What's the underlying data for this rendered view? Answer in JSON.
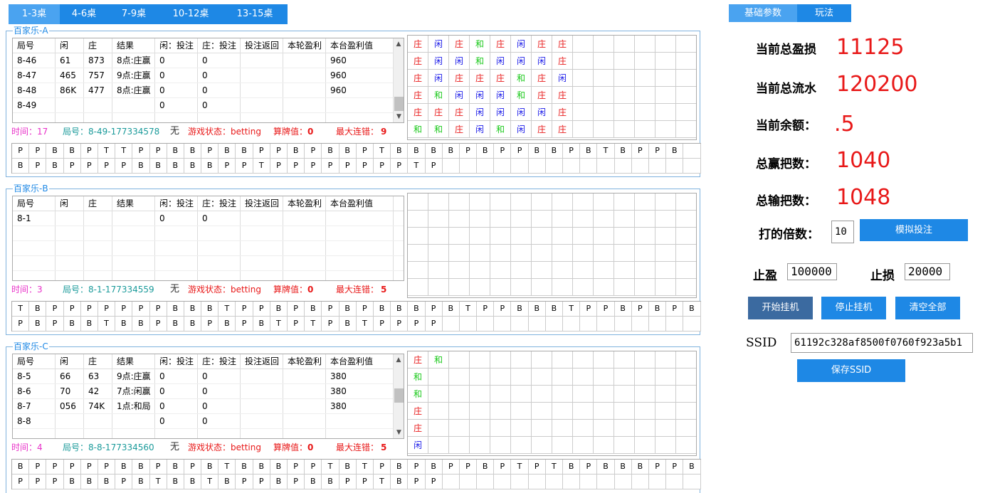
{
  "tabs": [
    "1-3桌",
    "4-6桌",
    "7-9桌",
    "10-12桌",
    "13-15桌"
  ],
  "columns": [
    "局号",
    "闲",
    "庄",
    "结果",
    "闲：投注",
    "庄：投注",
    "投注返回",
    "本轮盈利",
    "本台盈利值"
  ],
  "colors": {
    "banker": "#e81818",
    "player": "#1818e8",
    "tie": "#18c818"
  },
  "tables": [
    {
      "title": "百家乐-A",
      "scroll": true,
      "rows": [
        [
          "8-46",
          "61",
          "873",
          "8点:庄赢",
          "0",
          "0",
          "",
          "",
          "960"
        ],
        [
          "8-47",
          "465",
          "757",
          "9点:庄赢",
          "0",
          "0",
          "",
          "",
          "960"
        ],
        [
          "8-48",
          "86K",
          "477",
          "8点:庄赢",
          "0",
          "0",
          "",
          "",
          "960"
        ],
        [
          "8-49",
          "",
          "",
          "",
          "0",
          "0",
          "",
          "",
          ""
        ]
      ],
      "status": {
        "time": "时间：17",
        "round": "局号：8-49-177334578",
        "none": "无",
        "game_state": "游戏状态：betting",
        "count_label": "算牌值：",
        "count_value": "0",
        "streak_label": "最大连错：",
        "streak_value": "9"
      },
      "road": [
        [
          "庄",
          "闲",
          "庄",
          "和",
          "庄",
          "闲",
          "庄",
          "庄"
        ],
        [
          "庄",
          "闲",
          "闲",
          "和",
          "闲",
          "闲",
          "闲",
          "庄"
        ],
        [
          "庄",
          "闲",
          "庄",
          "庄",
          "庄",
          "和",
          "庄",
          "闲"
        ],
        [
          "庄",
          "和",
          "闲",
          "闲",
          "闲",
          "和",
          "庄",
          "庄"
        ],
        [
          "庄",
          "庄",
          "庄",
          "闲",
          "闲",
          "闲",
          "闲",
          "庄"
        ],
        [
          "和",
          "和",
          "庄",
          "闲",
          "和",
          "闲",
          "庄",
          "庄"
        ]
      ],
      "big_road": [
        [
          "P",
          "P",
          "B",
          "B",
          "P",
          "T",
          "T",
          "P",
          "P",
          "B",
          "B",
          "P",
          "B",
          "B",
          "P",
          "P",
          "B",
          "P",
          "B",
          "B",
          "P",
          "T",
          "B",
          "B",
          "B",
          "B",
          "P",
          "B",
          "P",
          "P",
          "B",
          "B",
          "P",
          "B",
          "T",
          "B",
          "P",
          "P",
          "B"
        ],
        [
          "B",
          "P",
          "B",
          "P",
          "P",
          "P",
          "P",
          "B",
          "B",
          "B",
          "B",
          "B",
          "P",
          "P",
          "T",
          "P",
          "P",
          "P",
          "P",
          "P",
          "P",
          "P",
          "P",
          "T",
          "P"
        ]
      ]
    },
    {
      "title": "百家乐-B",
      "scroll": false,
      "rows": [
        [
          "8-1",
          "",
          "",
          "",
          "0",
          "0",
          "",
          "",
          ""
        ]
      ],
      "status": {
        "time": "时间：3",
        "round": "局号：8-1-177334559",
        "none": "无",
        "game_state": "游戏状态：betting",
        "count_label": "算牌值：",
        "count_value": "0",
        "streak_label": "最大连错：",
        "streak_value": "5"
      },
      "road": [],
      "big_road": [
        [
          "T",
          "B",
          "P",
          "P",
          "P",
          "P",
          "P",
          "P",
          "P",
          "B",
          "B",
          "B",
          "T",
          "P",
          "P",
          "B",
          "P",
          "B",
          "P",
          "B",
          "P",
          "B",
          "B",
          "B",
          "P",
          "B",
          "T",
          "P",
          "P",
          "B",
          "B",
          "B",
          "T",
          "P",
          "P",
          "B",
          "P",
          "B",
          "P",
          "B"
        ],
        [
          "P",
          "B",
          "P",
          "B",
          "B",
          "T",
          "B",
          "B",
          "P",
          "B",
          "B",
          "P",
          "B",
          "P",
          "B",
          "T",
          "P",
          "T",
          "P",
          "B",
          "T",
          "P",
          "P",
          "P",
          "P"
        ]
      ]
    },
    {
      "title": "百家乐-C",
      "scroll": true,
      "rows": [
        [
          "8-5",
          "66",
          "63",
          "9点:庄赢",
          "0",
          "0",
          "",
          "",
          "380"
        ],
        [
          "8-6",
          "70",
          "42",
          "7点:闲赢",
          "0",
          "0",
          "",
          "",
          "380"
        ],
        [
          "8-7",
          "056",
          "74K",
          "1点:和局",
          "0",
          "0",
          "",
          "",
          "380"
        ],
        [
          "8-8",
          "",
          "",
          "",
          "0",
          "0",
          "",
          "",
          ""
        ]
      ],
      "status": {
        "time": "时间：4",
        "round": "局号：8-8-177334560",
        "none": "无",
        "game_state": "游戏状态：betting",
        "count_label": "算牌值：",
        "count_value": "0",
        "streak_label": "最大连错：",
        "streak_value": "5"
      },
      "road": [
        [
          "庄",
          "和"
        ],
        [
          "和",
          ""
        ],
        [
          "和",
          ""
        ],
        [
          "庄",
          ""
        ],
        [
          "庄",
          ""
        ],
        [
          "闲",
          ""
        ]
      ],
      "big_road": [
        [
          "B",
          "P",
          "P",
          "P",
          "P",
          "P",
          "B",
          "B",
          "P",
          "B",
          "P",
          "B",
          "T",
          "B",
          "B",
          "B",
          "P",
          "P",
          "T",
          "B",
          "T",
          "P",
          "B",
          "P",
          "B",
          "P",
          "P",
          "B",
          "P",
          "T",
          "P",
          "T",
          "B",
          "P",
          "B",
          "B",
          "B",
          "P",
          "P",
          "B"
        ],
        [
          "P",
          "P",
          "P",
          "B",
          "B",
          "B",
          "P",
          "B",
          "T",
          "B",
          "B",
          "T",
          "B",
          "P",
          "P",
          "B",
          "P",
          "B",
          "B",
          "P",
          "P",
          "T",
          "B",
          "P",
          "P"
        ]
      ]
    }
  ],
  "config": {
    "tab_basic": "基础参数",
    "tab_play": "玩法",
    "total_pl_label": "当前总盈损",
    "total_pl_value": "11125",
    "total_flow_label": "当前总流水",
    "total_flow_value": "120200",
    "balance_label": "当前余额：",
    "balance_value": ".5",
    "total_win_label": "总赢把数：",
    "total_win_value": "1040",
    "total_lose_label": "总输把数：",
    "total_lose_value": "1048",
    "multiplier_label": "打的倍数：",
    "multiplier_value": "10",
    "simulate_button": "模拟投注",
    "take_profit_label": "止盈",
    "take_profit_value": "100000",
    "stop_loss_label": "止损",
    "stop_loss_value": "20000",
    "start_button": "开始挂机",
    "stop_button": "停止挂机",
    "clear_button": "清空全部",
    "ssid_label": "SSID",
    "ssid_value": "61192c328af8500f0760f923a5b1",
    "save_ssid_button": "保存SSID"
  }
}
